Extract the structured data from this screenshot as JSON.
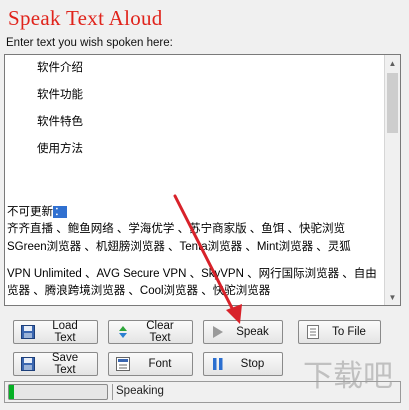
{
  "app": {
    "title": "Speak Text Aloud",
    "prompt": "Enter text you wish spoken here:"
  },
  "editor": {
    "lines": [
      {
        "text": "软件介绍",
        "indent": true
      },
      {
        "text": "软件功能",
        "indent": true
      },
      {
        "text": "软件特色",
        "indent": true
      },
      {
        "text": "使用方法",
        "indent": true
      },
      {
        "text": "不可更新",
        "indent": false,
        "selected_suffix": "："
      },
      {
        "text": "齐齐直播 、鲍鱼网络 、学海优学 、苏宁商家版 、鱼饵 、快驼浏览",
        "indent": false
      },
      {
        "text": "SGreen浏览器 、机翅膀浏览器 、Tenta浏览器 、Mint浏览器 、灵狐",
        "indent": false
      },
      {
        "text": "VPN Unlimited 、AVG Secure VPN 、SkyVPN 、网行国际浏览器 、自由",
        "indent": false
      },
      {
        "text": "览器 、腾浪跨境浏览器 、Cool浏览器 、快驼浏览器",
        "indent": false
      }
    ]
  },
  "buttons": {
    "load_text": "Load Text",
    "clear_text": "Clear Text",
    "speak": "Speak",
    "to_file": "To File",
    "save_text": "Save Text",
    "font": "Font",
    "stop": "Stop"
  },
  "icons": {
    "load_text": "disk-icon",
    "clear_text": "recycle-icon",
    "speak": "play-icon",
    "to_file": "file-icon",
    "save_text": "disk-icon",
    "font": "font-icon",
    "stop": "pause-icon"
  },
  "status": {
    "text": "Speaking",
    "progress": 0.05
  },
  "watermark": {
    "text": "下载吧"
  },
  "colors": {
    "title": "#e0231b",
    "selection": "#3070d0",
    "arrow": "#d8222a",
    "progress": "#06b025"
  }
}
